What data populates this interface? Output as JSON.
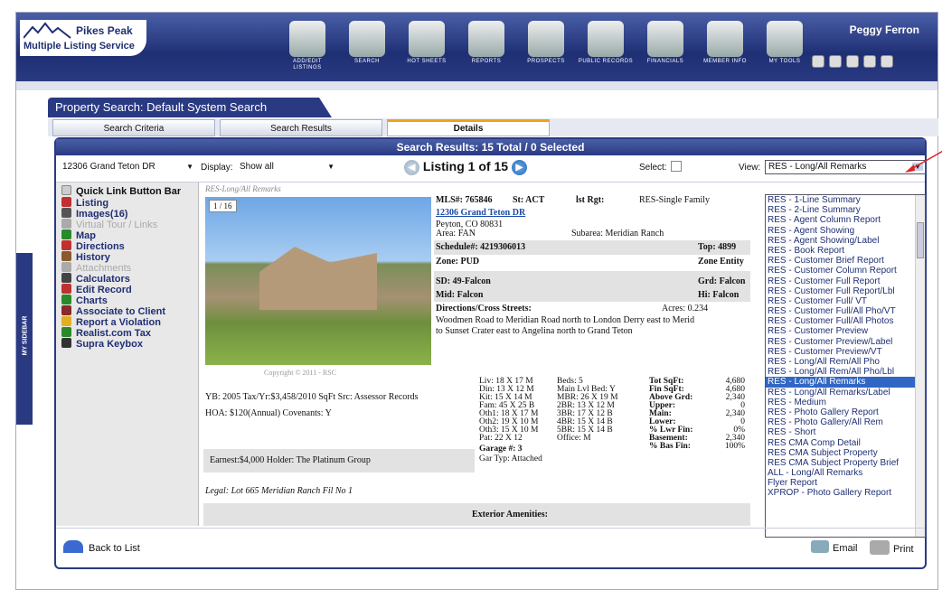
{
  "header": {
    "logo_line1": "Pikes Peak",
    "logo_line2": "Multiple Listing Service",
    "user": "Peggy Ferron",
    "nav": [
      {
        "label": "ADD/EDIT LISTINGS"
      },
      {
        "label": "SEARCH"
      },
      {
        "label": "HOT SHEETS"
      },
      {
        "label": "REPORTS"
      },
      {
        "label": "PROSPECTS"
      },
      {
        "label": "PUBLIC RECORDS"
      },
      {
        "label": "FINANCIALS"
      },
      {
        "label": "MEMBER INFO"
      },
      {
        "label": "MY TOOLS"
      }
    ]
  },
  "sidebar_tab": "MY SIDEBAR",
  "page_title": "Property Search:  Default System Search",
  "tabs": [
    "Search Criteria",
    "Search Results",
    "Details"
  ],
  "results_header": "Search Results: 15 Total / 0 Selected",
  "controls": {
    "address": "12306 Grand Teton DR",
    "display_label": "Display:",
    "display_value": "Show all",
    "listing_label": "Listing 1 of 15",
    "select_label": "Select:",
    "view_label": "View:",
    "view_value": "RES - Long/All Remarks"
  },
  "quick_links": {
    "title": "Quick Link Button Bar",
    "items": [
      {
        "label": "Listing",
        "color": "#c03030"
      },
      {
        "label": "Images(16)",
        "color": "#555"
      },
      {
        "label": "Virtual Tour / Links",
        "color": "#aaa",
        "disabled": true
      },
      {
        "label": "Map",
        "color": "#2a8a2a"
      },
      {
        "label": "Directions",
        "color": "#c03030"
      },
      {
        "label": "History",
        "color": "#8a5a2a"
      },
      {
        "label": "Attachments",
        "color": "#aaa",
        "disabled": true
      },
      {
        "label": "Calculators",
        "color": "#444"
      },
      {
        "label": "Edit Record",
        "color": "#c03030"
      },
      {
        "label": "Charts",
        "color": "#2a8a2a"
      },
      {
        "label": "Associate to Client",
        "color": "#8a2a2a"
      },
      {
        "label": "Report a Violation",
        "color": "#e0b020"
      },
      {
        "label": "Realist.com Tax",
        "color": "#2a8a2a"
      },
      {
        "label": "Supra Keybox",
        "color": "#333"
      }
    ]
  },
  "detail": {
    "report_name": "RES-Long/All Remarks",
    "photo_counter": "1 / 16",
    "copyright": "Copyright © 2011 - RSC",
    "mls": "MLS#: 765846",
    "st": "St: ACT",
    "lst_rgt": "lst Rgt:",
    "prop_type": "RES-Single Family",
    "address": "12306 Grand Teton DR",
    "city": "Peyton, CO  80831",
    "area": "Area: FAN",
    "subarea": "Subarea: Meridian Ranch",
    "schedule": "Schedule#: 4219306013",
    "top": "Top: 4899",
    "zone": "Zone: PUD",
    "zone_entity": "Zone Entity",
    "sd": "SD: 49-Falcon",
    "grd": "Grd: Falcon",
    "mid": "Mid: Falcon",
    "hi": "Hi: Falcon",
    "directions_label": "Directions/Cross Streets:",
    "acres": "Acres: 0.234",
    "directions_line1": "Woodmen Road to Meridian Road north to London Derry east to Merid",
    "directions_line2": "to Sunset Crater east to Angelina north to Grand Teton",
    "yb": "YB: 2005 Tax/Yr:$3,458/2010  SqFt Src: Assessor Records",
    "hoa": "HOA: $120(Annual)  Covenants: Y",
    "earnest": "Earnest:$4,000 Holder: The Platinum Group",
    "legal": "Legal: Lot 665 Meridian Ranch Fil No 1",
    "exterior": "Exterior Amenities:",
    "rooms_col1": [
      "Liv:  18 X 17 M",
      "Din:  13 X 12 M",
      "Kit:  15 X 14 M",
      "Fam:  45 X 25 B",
      "Oth1: 18 X 17 M",
      "Oth2: 19 X 10 M",
      "Oth3: 15 X 10 M",
      "Pat:  22 X 12"
    ],
    "rooms_col2": [
      "Beds:  5",
      "Main Lvl Bed: Y",
      "MBR:  26 X 19 M",
      "2BR:  13 X 12 M",
      "3BR:  17 X 12 B",
      "4BR:  15 X 14 B",
      "5BR:  15 X 14 B",
      "Office:  M"
    ],
    "garage": "Garage #: 3",
    "gar_typ": "Gar Typ: Attached",
    "sqft_labels": [
      "Tot SqFt:",
      "Fin SqFt:",
      "Above Grd:",
      "Upper:",
      "Main:",
      "Lower:",
      "% Lwr Fin:",
      "Basement:",
      "% Bas Fin:"
    ],
    "sqft_values": [
      "4,680",
      "4,680",
      "2,340",
      "0",
      "2,340",
      "0",
      "0%",
      "2,340",
      "100%"
    ]
  },
  "view_options": [
    "RES - 1-Line Summary",
    "RES - 2-Line Summary",
    "RES - Agent Column Report",
    "RES - Agent Showing",
    "RES - Agent Showing/Label",
    "RES - Book Report",
    "RES - Customer Brief Report",
    "RES - Customer Column Report",
    "RES - Customer Full Report",
    "RES - Customer Full Report/Lbl",
    "RES - Customer Full/ VT",
    "RES - Customer Full/All Pho/VT",
    "RES - Customer Full/All Photos",
    "RES - Customer Preview",
    "RES - Customer Preview/Label",
    "RES - Customer Preview/VT",
    "RES - Long/All Rem/All Pho",
    "RES - Long/All Rem/All Pho/Lbl",
    "RES - Long/All Remarks",
    "RES - Long/All Remarks/Label",
    "RES - Medium",
    "RES - Photo Gallery Report",
    "RES - Photo Gallery/All Rem",
    "RES - Short",
    "RES CMA Comp Detail",
    "RES CMA Subject Property",
    "RES CMA Subject Property Brief",
    "ALL - Long/All Remarks",
    "Flyer Report",
    "XPROP - Photo Gallery Report"
  ],
  "selected_view_index": 18,
  "footer": {
    "back": "Back to List",
    "email": "Email",
    "print": "Print"
  }
}
